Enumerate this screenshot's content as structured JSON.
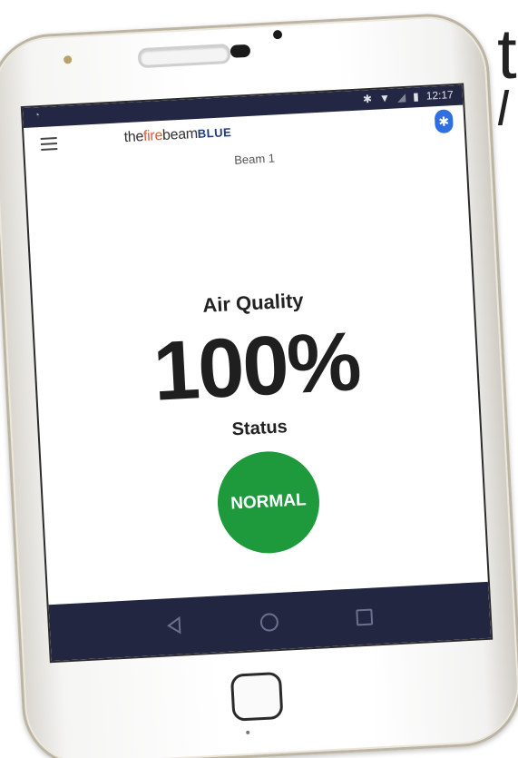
{
  "edge_heading": {
    "line1": "t",
    "line2": "l"
  },
  "status_bar": {
    "time": "12:17",
    "left_indicator": "◔"
  },
  "app_bar": {
    "brand": {
      "part1": "the",
      "part2": "fire",
      "part3": "beam",
      "part4": "BLUE"
    },
    "bluetooth_label": "✱"
  },
  "device": {
    "name": "Beam 1"
  },
  "reading": {
    "label": "Air Quality",
    "value": "100%",
    "status_label": "Status",
    "status_value": "NORMAL",
    "status_color": "#1e9a3c"
  },
  "nav": {
    "back_icon": "back-icon",
    "home_icon": "home-icon",
    "recents_icon": "recents-icon"
  }
}
